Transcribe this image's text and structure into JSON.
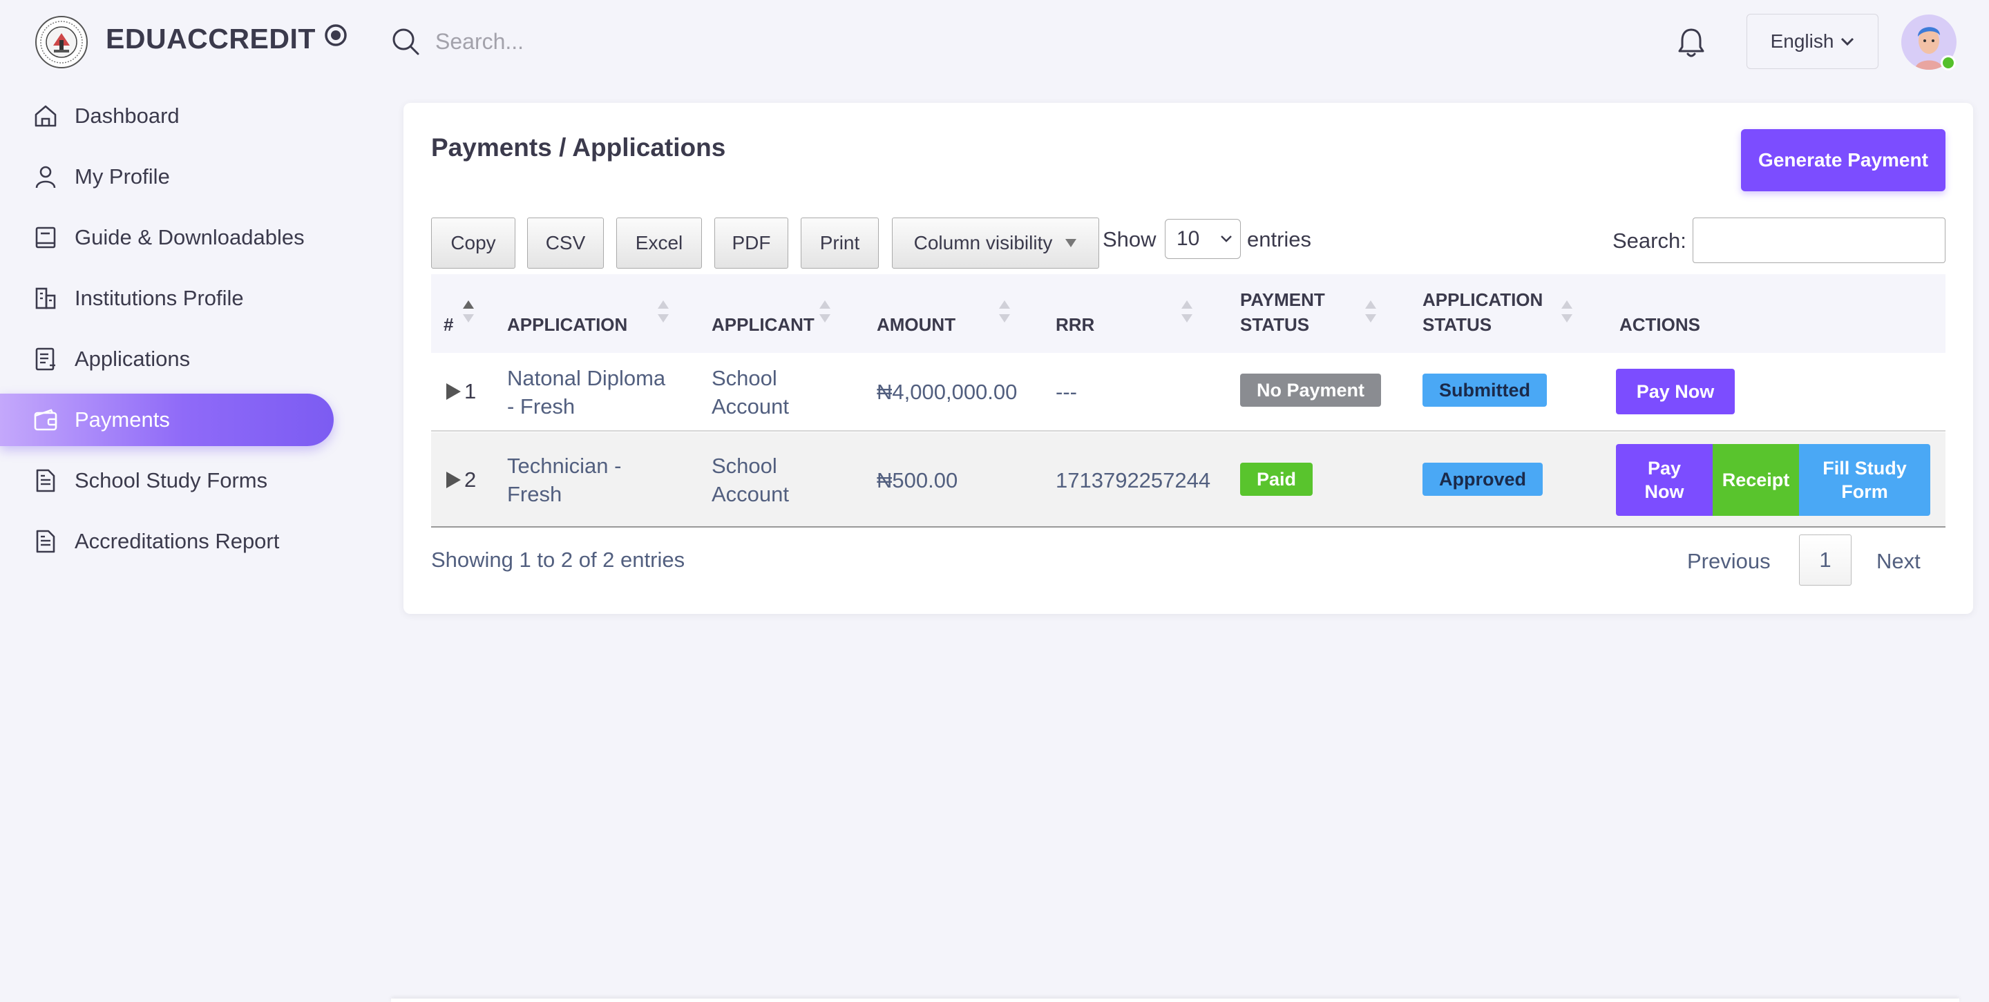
{
  "header": {
    "brand": "EDUACCREDIT",
    "search_placeholder": "Search...",
    "language": "English"
  },
  "sidebar": {
    "items": [
      {
        "label": "Dashboard",
        "icon": "home-icon"
      },
      {
        "label": "My Profile",
        "icon": "user-icon"
      },
      {
        "label": "Guide & Downloadables",
        "icon": "book-icon"
      },
      {
        "label": "Institutions Profile",
        "icon": "building-icon"
      },
      {
        "label": "Applications",
        "icon": "document-list-icon"
      },
      {
        "label": "Payments",
        "icon": "wallet-icon",
        "active": true
      },
      {
        "label": "School Study Forms",
        "icon": "file-text-icon"
      },
      {
        "label": "Accreditations Report",
        "icon": "file-text-icon"
      }
    ]
  },
  "main": {
    "title": "Payments / Applications",
    "generate_button": "Generate Payment",
    "toolbar": {
      "copy": "Copy",
      "csv": "CSV",
      "excel": "Excel",
      "pdf": "PDF",
      "print": "Print",
      "column_visibility": "Column visibility",
      "show_label": "Show",
      "entries_value": "10",
      "entries_label": "entries",
      "search_label": "Search:"
    },
    "table": {
      "headers": {
        "num": "#",
        "application": "APPLICATION",
        "applicant": "APPLICANT",
        "amount": "AMOUNT",
        "rrr": "RRR",
        "payment_status_1": "PAYMENT",
        "payment_status_2": "STATUS",
        "application_status_1": "APPLICATION",
        "application_status_2": "STATUS",
        "actions": "ACTIONS"
      },
      "rows": [
        {
          "num": "1",
          "application_1": "Natonal Diploma",
          "application_2": "- Fresh",
          "applicant_1": "School",
          "applicant_2": "Account",
          "amount": "₦4,000,000.00",
          "rrr": "---",
          "payment_status": "No Payment",
          "application_status": "Submitted",
          "actions": {
            "pay_now": "Pay Now"
          }
        },
        {
          "num": "2",
          "application_1": "Technician -",
          "application_2": "Fresh",
          "applicant_1": "School",
          "applicant_2": "Account",
          "amount": "₦500.00",
          "rrr": "1713792257244",
          "payment_status": "Paid",
          "application_status": "Approved",
          "actions": {
            "pay_now_1": "Pay",
            "pay_now_2": "Now",
            "receipt": "Receipt",
            "fill_1": "Fill Study",
            "fill_2": "Form"
          }
        }
      ]
    },
    "info": "Showing 1 to 2 of 2 entries",
    "pagination": {
      "previous": "Previous",
      "current": "1",
      "next": "Next"
    }
  },
  "colors": {
    "accent": "#7c4dff",
    "success": "#59c42d",
    "info": "#4aa8f5",
    "muted": "#8a8c91"
  }
}
